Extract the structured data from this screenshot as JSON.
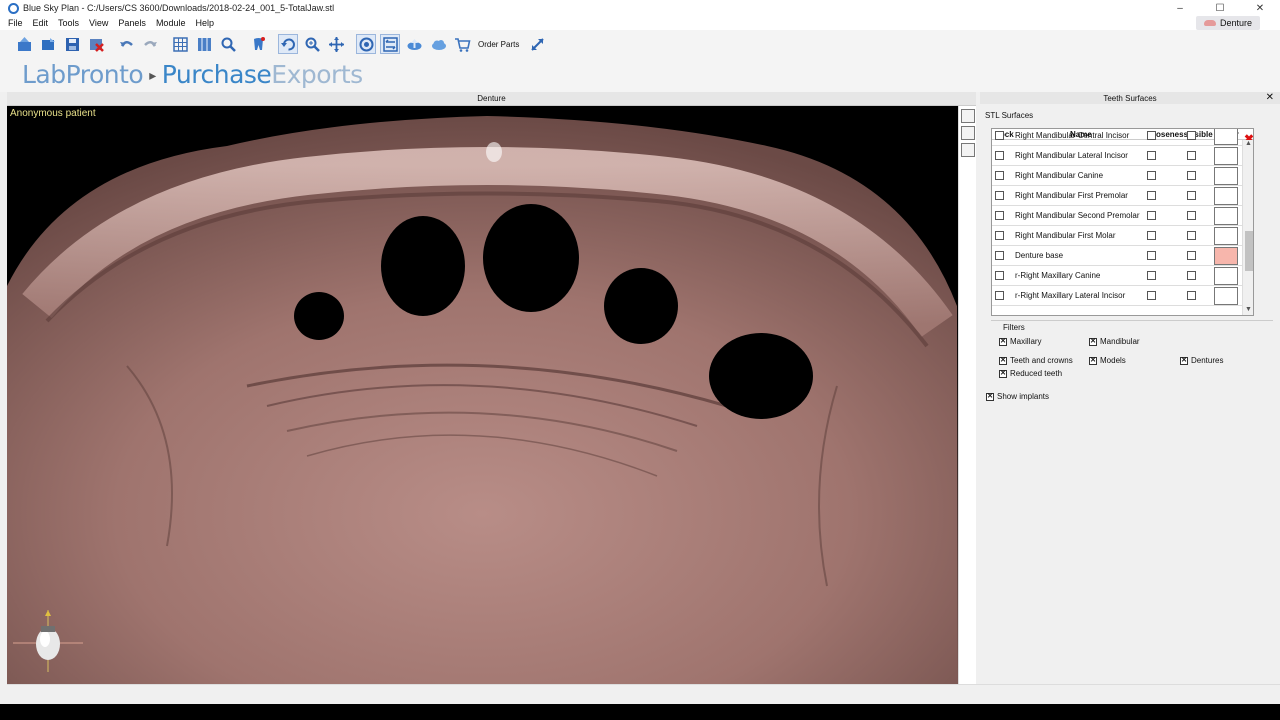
{
  "window": {
    "title": "Blue Sky Plan - C:/Users/CS 3600/Downloads/2018-02-24_001_5-TotalJaw.stl",
    "minimize": "–",
    "maximize": "☐",
    "close": "✕"
  },
  "menu": {
    "file": "File",
    "edit": "Edit",
    "tools": "Tools",
    "view": "View",
    "panels": "Panels",
    "module": "Module",
    "help": "Help"
  },
  "module_tag": {
    "label": "Denture",
    "icon": "lips-icon"
  },
  "toolbar": {
    "order_parts_label": "Order Parts"
  },
  "brand": {
    "lab": "LabPronto",
    "purchase": "Purchase",
    "exports": "Exports"
  },
  "viewport": {
    "header": "Denture",
    "patient": "Anonymous patient"
  },
  "panel": {
    "title": "Teeth Surfaces",
    "close": "✕",
    "section": "STL Surfaces",
    "columns": {
      "lock": "Lock",
      "name": "Name",
      "closeness": "Closeness",
      "visible": "Visible",
      "color": "Color"
    },
    "rows": [
      {
        "name": "Right Mandibular Central Incisor",
        "color": "#ffffff"
      },
      {
        "name": "Right Mandibular Lateral Incisor",
        "color": "#ffffff"
      },
      {
        "name": "Right Mandibular Canine",
        "color": "#ffffff"
      },
      {
        "name": "Right Mandibular First Premolar",
        "color": "#ffffff"
      },
      {
        "name": "Right Mandibular Second Premolar",
        "color": "#ffffff"
      },
      {
        "name": "Right Mandibular First Molar",
        "color": "#ffffff"
      },
      {
        "name": "Denture base",
        "color": "#f7b6ac"
      },
      {
        "name": "r-Right Maxillary Canine",
        "color": "#ffffff"
      },
      {
        "name": "r-Right Maxillary Lateral Incisor",
        "color": "#ffffff"
      }
    ],
    "delete_glyph": "✖",
    "filters": {
      "title": "Filters",
      "maxillary": "Maxillary",
      "mandibular": "Mandibular",
      "teeth_and_crowns": "Teeth and crowns",
      "models": "Models",
      "dentures": "Dentures",
      "reduced_teeth": "Reduced teeth"
    },
    "show_implants": "Show implants"
  }
}
